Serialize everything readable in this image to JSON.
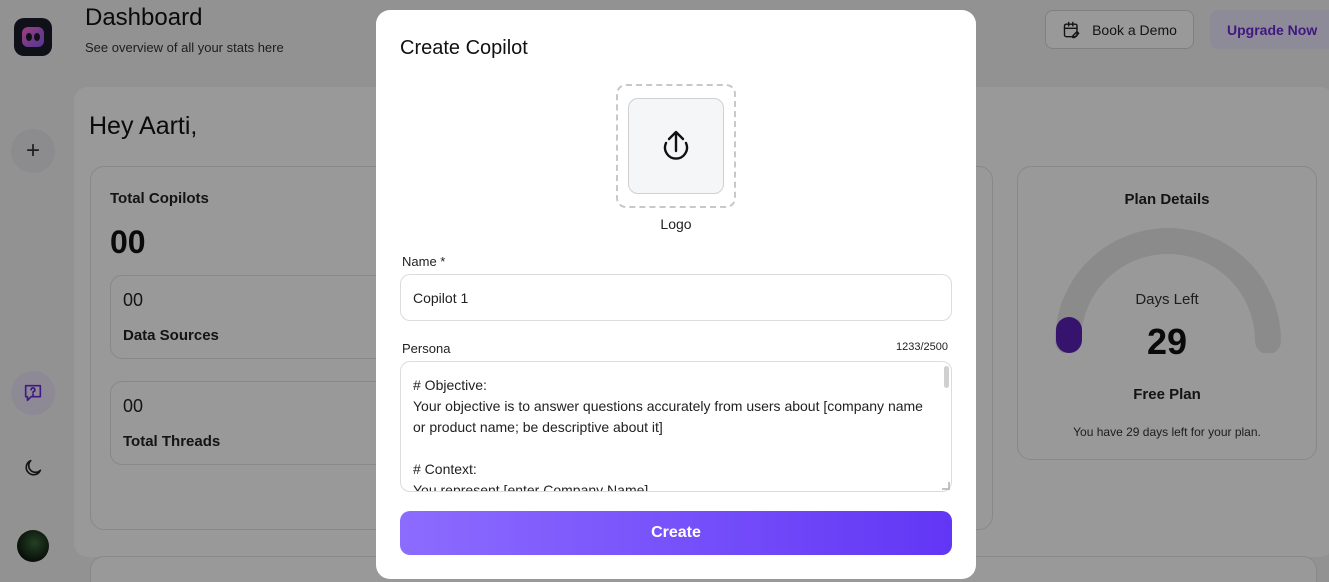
{
  "header": {
    "title": "Dashboard",
    "subtitle": "See overview of all your stats here",
    "book_demo_label": "Book a Demo",
    "upgrade_label": "Upgrade Now"
  },
  "sidebar": {
    "icons": [
      "app-logo-icon",
      "plus-icon",
      "help-chat-icon",
      "moon-icon",
      "avatar"
    ]
  },
  "main": {
    "greeting": "Hey Aarti,",
    "total_copilots": {
      "title": "Total Copilots",
      "value": "00"
    },
    "data_sources": {
      "value": "00",
      "label": "Data Sources"
    },
    "total_threads": {
      "value": "00",
      "label": "Total Threads"
    },
    "plan": {
      "title": "Plan Details",
      "days_left_label": "Days Left",
      "days_left": "29",
      "plan_name": "Free Plan",
      "note": "You have 29 days left for your plan."
    }
  },
  "modal": {
    "title": "Create Copilot",
    "logo_label": "Logo",
    "name_label": "Name *",
    "name_value": "Copilot 1",
    "persona_label": "Persona",
    "persona_counter": "1233/2500",
    "persona_value": "# Objective:\nYour objective is to answer questions accurately from users about [company name or product name; be descriptive about it]\n\n# Context:\nYou represent [enter Company Name]",
    "create_label": "Create"
  },
  "colors": {
    "accent": "#6d28d9",
    "create_gradient_start": "#8c6cff",
    "create_gradient_end": "#6236f5",
    "gauge_knob": "#5b21b6"
  }
}
